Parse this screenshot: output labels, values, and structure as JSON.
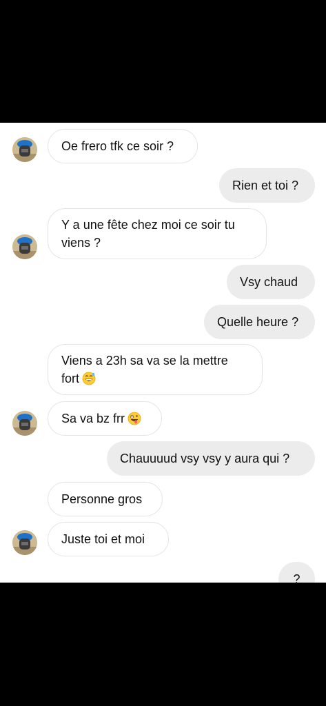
{
  "contact": {
    "avatar_icon": "profile-avatar-blue-hat-icon"
  },
  "messages": [
    {
      "side": "in",
      "text": "Oe frero tfk ce soir ?"
    },
    {
      "side": "out",
      "text": "Rien et toi ?"
    },
    {
      "side": "in",
      "line1": "Y a une fête chez moi ce soir tu",
      "line2": "viens ?"
    },
    {
      "side": "out",
      "text": "Vsy chaud"
    },
    {
      "side": "out",
      "text": "Quelle heure ?"
    },
    {
      "side": "in",
      "line1": "Viens a 23h sa va se la mettre",
      "line2": "fort",
      "emoji": "grinning-sweat-face-emoji"
    },
    {
      "side": "in",
      "text": "Sa va bz frr",
      "emoji": "zany-face-emoji"
    },
    {
      "side": "out",
      "text": "Chauuuud vsy vsy y aura qui ?"
    },
    {
      "side": "in",
      "text": "Personne gros"
    },
    {
      "side": "in",
      "text": "Juste toi et moi"
    },
    {
      "side": "out",
      "text": "?"
    }
  ],
  "colors": {
    "incoming_bubble": "#ffffff",
    "outgoing_bubble": "#ececec",
    "background": "#ffffff",
    "frame": "#000000"
  }
}
